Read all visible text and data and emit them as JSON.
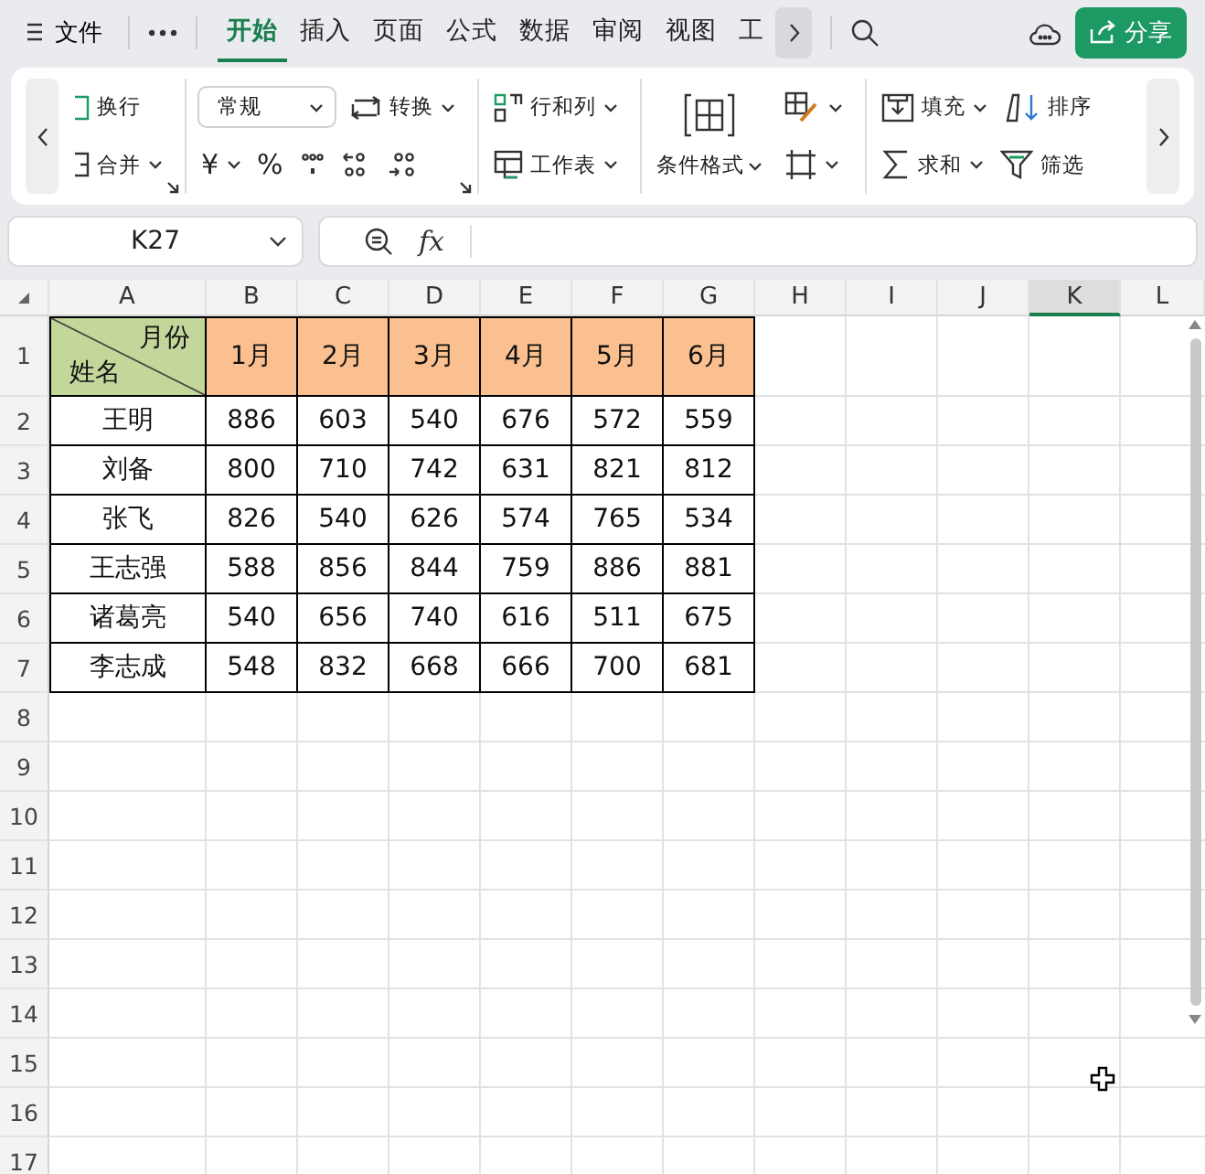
{
  "top_bar": {
    "file_menu": "文件",
    "tabs": [
      {
        "label": "开始",
        "selected": true
      },
      {
        "label": "插入",
        "selected": false
      },
      {
        "label": "页面",
        "selected": false
      },
      {
        "label": "公式",
        "selected": false
      },
      {
        "label": "数据",
        "selected": false
      },
      {
        "label": "审阅",
        "selected": false
      },
      {
        "label": "视图",
        "selected": false
      },
      {
        "label": "工",
        "selected": false
      }
    ],
    "share_button": "分享"
  },
  "ribbon": {
    "groups": [
      {
        "launcher": true,
        "rows": [
          [
            {
              "kind": "button",
              "label": "换行"
            }
          ],
          [
            {
              "kind": "dropdown",
              "label": "合并"
            }
          ]
        ]
      },
      {
        "launcher": true,
        "rows": [
          [
            {
              "kind": "select",
              "label": "常规"
            },
            {
              "kind": "dropdown",
              "label": "转换"
            }
          ],
          [
            {
              "kind": "text_dropdown",
              "label": "¥"
            },
            {
              "kind": "text_button",
              "label": "%"
            },
            {
              "kind": "icon_button"
            },
            {
              "kind": "icon_button"
            },
            {
              "kind": "icon_button"
            }
          ]
        ]
      },
      {
        "rows": [
          [
            {
              "kind": "dropdown",
              "label": "行和列"
            }
          ],
          [
            {
              "kind": "dropdown",
              "label": "工作表"
            }
          ]
        ]
      },
      {
        "big": {
          "kind": "big_dropdown",
          "label": "条件格式"
        },
        "rows": [
          [
            {
              "kind": "icon_dropdown"
            }
          ],
          [
            {
              "kind": "icon_dropdown"
            }
          ]
        ]
      },
      {
        "rows": [
          [
            {
              "kind": "dropdown",
              "label": "填充"
            },
            {
              "kind": "button",
              "label": "排序"
            }
          ],
          [
            {
              "kind": "dropdown",
              "label": "求和"
            },
            {
              "kind": "button",
              "label": "筛选"
            }
          ]
        ]
      }
    ]
  },
  "formula_bar": {
    "name_box": "K27",
    "function_label": "fx"
  },
  "sheet": {
    "columns": [
      {
        "label": "A",
        "selected": false
      },
      {
        "label": "B",
        "selected": false
      },
      {
        "label": "C",
        "selected": false
      },
      {
        "label": "D",
        "selected": false
      },
      {
        "label": "E",
        "selected": false
      },
      {
        "label": "F",
        "selected": false
      },
      {
        "label": "G",
        "selected": false
      },
      {
        "label": "H",
        "selected": false
      },
      {
        "label": "I",
        "selected": false
      },
      {
        "label": "J",
        "selected": false
      },
      {
        "label": "K",
        "selected": true
      },
      {
        "label": "L",
        "selected": false
      }
    ],
    "rows": [
      "1",
      "2",
      "3",
      "4",
      "5",
      "6",
      "7",
      "8",
      "9",
      "10",
      "11",
      "12",
      "13",
      "14",
      "15",
      "16",
      "17"
    ],
    "table": {
      "corner": {
        "top": "月份",
        "bottom": "姓名"
      },
      "months": [
        "1月",
        "2月",
        "3月",
        "4月",
        "5月",
        "6月"
      ],
      "rows": [
        {
          "name": "王明",
          "values": [
            "886",
            "603",
            "540",
            "676",
            "572",
            "559"
          ]
        },
        {
          "name": "刘备",
          "values": [
            "800",
            "710",
            "742",
            "631",
            "821",
            "812"
          ]
        },
        {
          "name": "张飞",
          "values": [
            "826",
            "540",
            "626",
            "574",
            "765",
            "534"
          ]
        },
        {
          "name": "王志强",
          "values": [
            "588",
            "856",
            "844",
            "759",
            "886",
            "881"
          ]
        },
        {
          "name": "诸葛亮",
          "values": [
            "540",
            "656",
            "740",
            "616",
            "511",
            "675"
          ]
        },
        {
          "name": "李志成",
          "values": [
            "548",
            "832",
            "668",
            "666",
            "700",
            "681"
          ]
        }
      ]
    }
  }
}
